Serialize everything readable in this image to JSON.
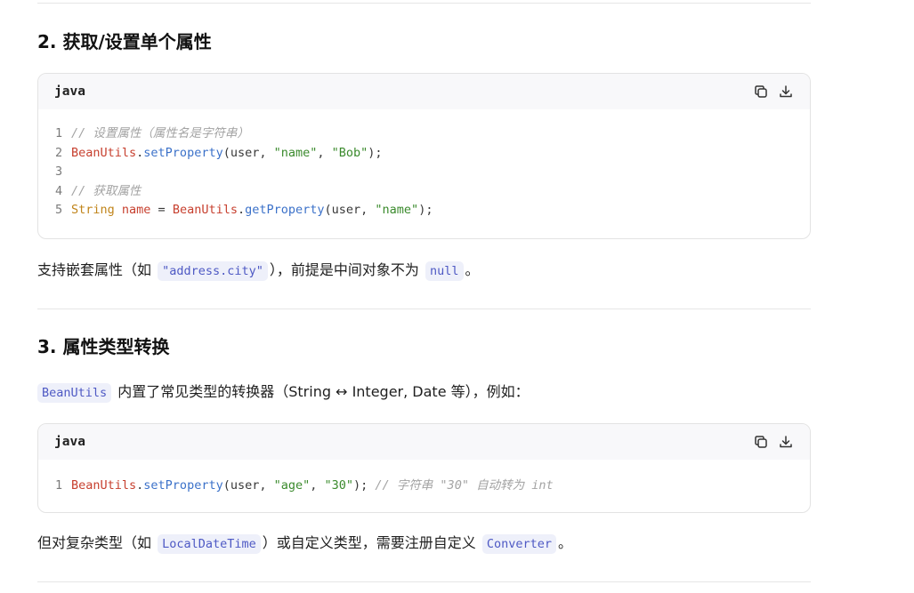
{
  "section2": {
    "heading": "2. 获取/设置单个属性",
    "code": {
      "lang": "java",
      "lines": [
        "1",
        "2",
        "3",
        "4",
        "5"
      ],
      "l1_comment": "// 设置属性（属性名是字符串）",
      "l2_class": "BeanUtils",
      "l2_dot": ".",
      "l2_method": "setProperty",
      "l2_open": "(user, ",
      "l2_str1": "\"name\"",
      "l2_sep": ", ",
      "l2_str2": "\"Bob\"",
      "l2_close": ");",
      "l4_comment": "// 获取属性",
      "l5_type": "String",
      "l5_var": " name",
      "l5_eq": " = ",
      "l5_class": "BeanUtils",
      "l5_dot": ".",
      "l5_method": "getProperty",
      "l5_open": "(user, ",
      "l5_str": "\"name\"",
      "l5_close": ");"
    },
    "para_prefix": "支持嵌套属性（如 ",
    "para_code1": "\"address.city\"",
    "para_mid": "），前提是中间对象不为 ",
    "para_code2": "null",
    "para_suffix": "。"
  },
  "section3": {
    "heading": "3. 属性类型转换",
    "intro_code": "BeanUtils",
    "intro_text": " 内置了常见类型的转换器（String ↔ Integer, Date 等），例如：",
    "code": {
      "lang": "java",
      "line_num": "1",
      "class": "BeanUtils",
      "dot": ".",
      "method": "setProperty",
      "open": "(user, ",
      "str1": "\"age\"",
      "sep": ", ",
      "str2": "\"30\"",
      "close": "); ",
      "comment": "// 字符串 \"30\" 自动转为 int"
    },
    "para_prefix": "但对复杂类型（如 ",
    "para_code1": "LocalDateTime",
    "para_mid": "）或自定义类型，需要注册自定义 ",
    "para_code2": "Converter",
    "para_suffix": "。"
  },
  "icons": {
    "copy": "copy-icon",
    "download": "download-icon"
  }
}
